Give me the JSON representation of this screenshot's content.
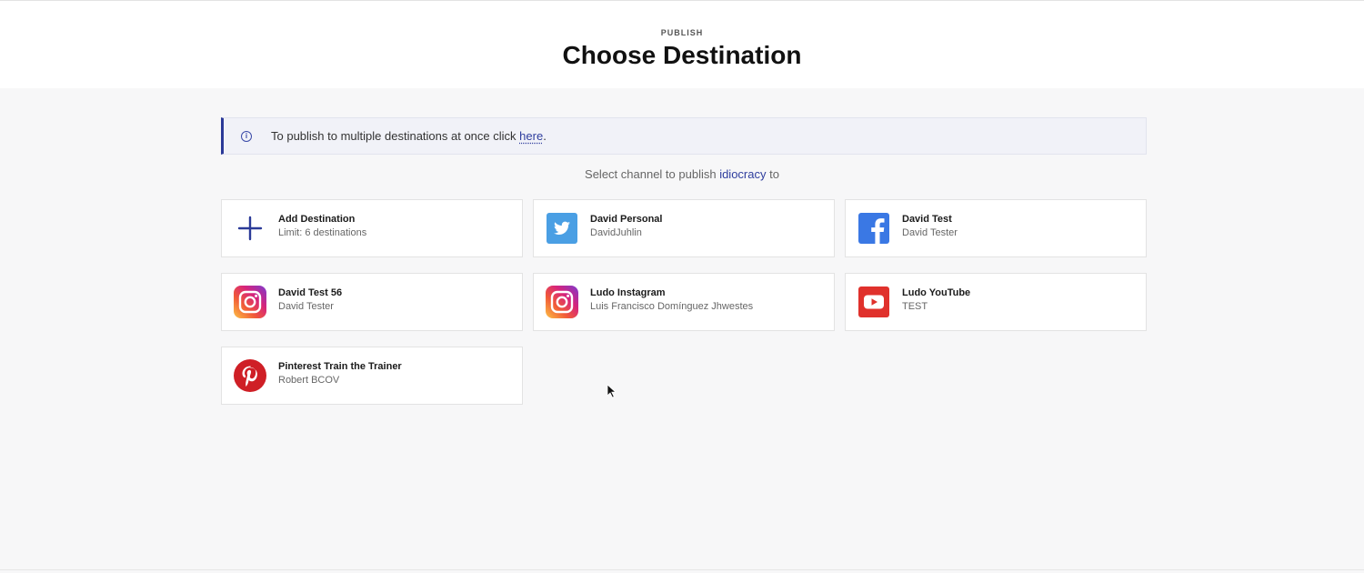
{
  "header": {
    "eyebrow": "PUBLISH",
    "title": "Choose Destination"
  },
  "banner": {
    "text_before": "To publish to multiple destinations at once click ",
    "link_text": "here",
    "text_after": ".",
    "icon": "info-icon"
  },
  "subtitle": {
    "prefix": "Select channel to publish ",
    "project": "idiocracy",
    "suffix": " to"
  },
  "destinations": [
    {
      "name": "Add Destination",
      "sub": "Limit: 6 destinations",
      "icon": "plus-icon"
    },
    {
      "name": "David Personal",
      "sub": "DavidJuhlin",
      "icon": "twitter-icon"
    },
    {
      "name": "David Test",
      "sub": "David Tester",
      "icon": "facebook-icon"
    },
    {
      "name": "David Test 56",
      "sub": "David Tester",
      "icon": "instagram-icon"
    },
    {
      "name": "Ludo Instagram",
      "sub": "Luis Francisco Domínguez Jhwestes",
      "icon": "instagram-icon"
    },
    {
      "name": "Ludo YouTube",
      "sub": "TEST",
      "icon": "youtube-icon"
    },
    {
      "name": "Pinterest Train the Trainer",
      "sub": "Robert BCOV",
      "icon": "pinterest-icon"
    }
  ],
  "colors": {
    "accent": "#2b3a98",
    "twitter": "#4a9fe4",
    "facebook": "#3a78e4",
    "youtube": "#e0312c",
    "pinterest": "#cf1f26"
  }
}
